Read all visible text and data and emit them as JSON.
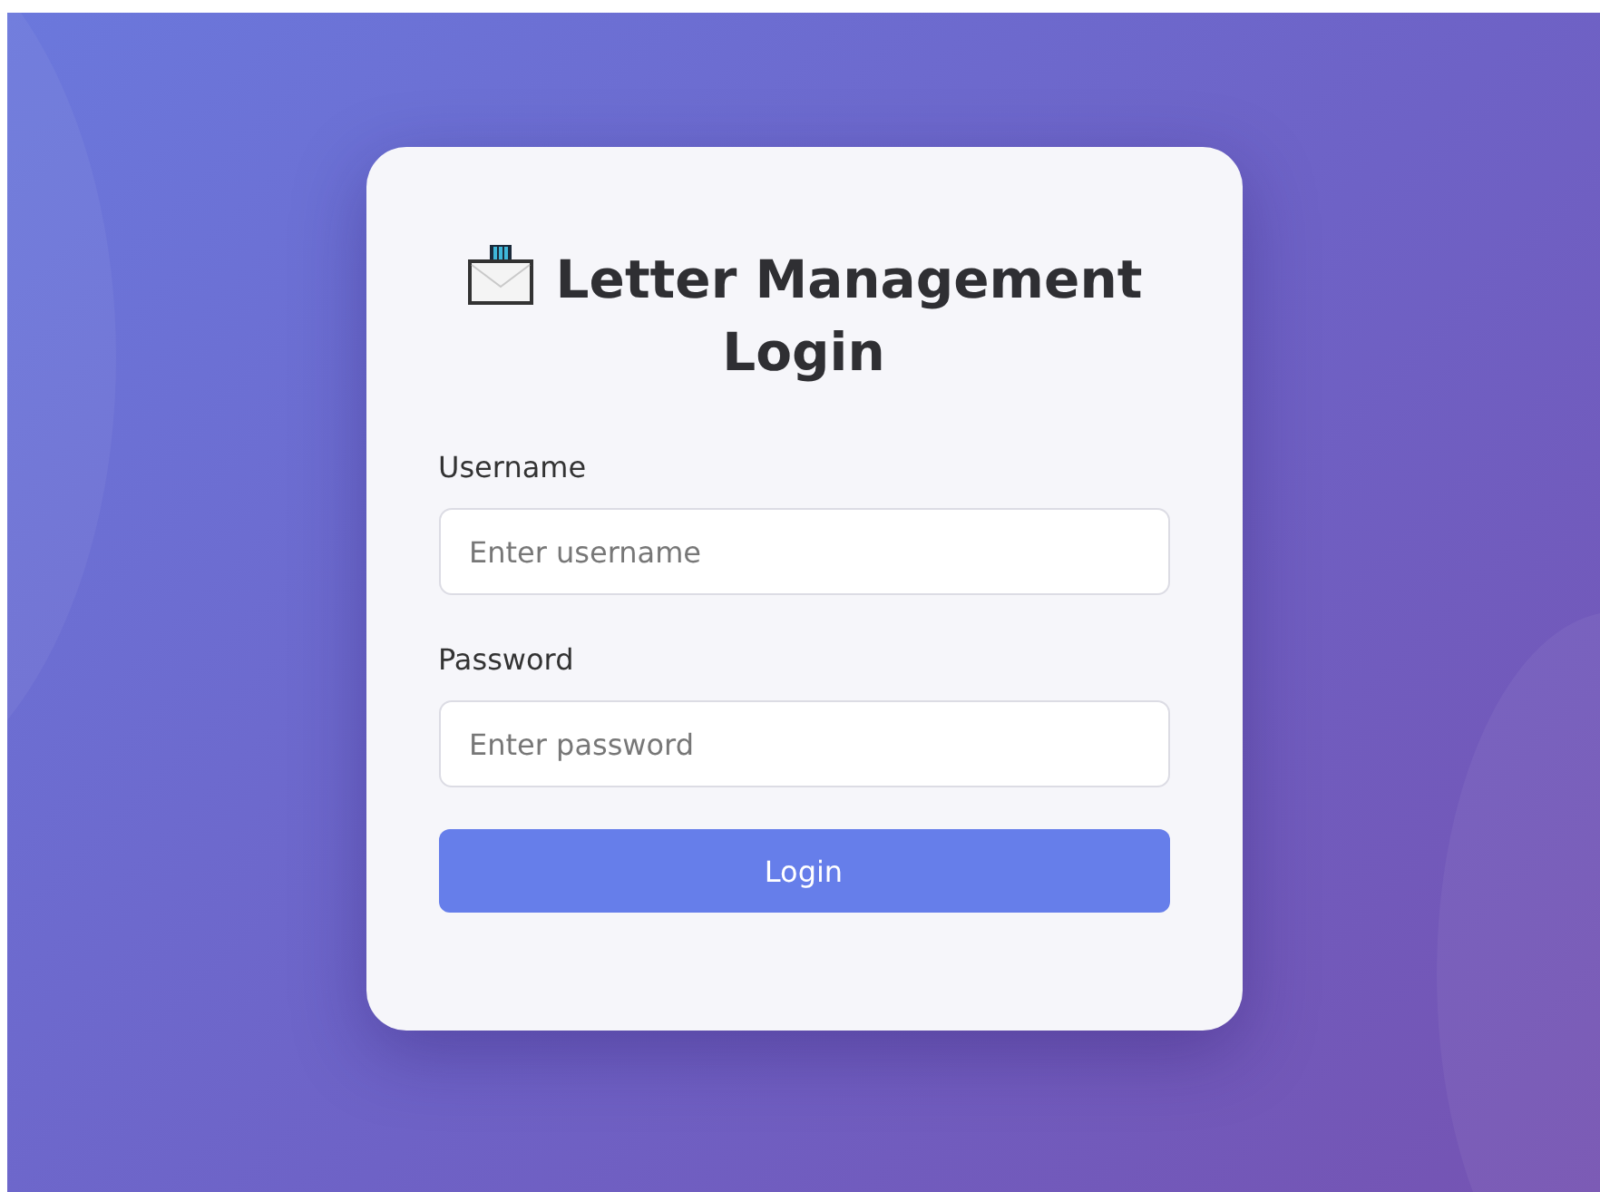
{
  "title": "Letter Management Login",
  "fields": [
    {
      "label": "Username",
      "placeholder": "Enter username"
    },
    {
      "label": "Password",
      "placeholder": "Enter password"
    }
  ],
  "button": "Login"
}
